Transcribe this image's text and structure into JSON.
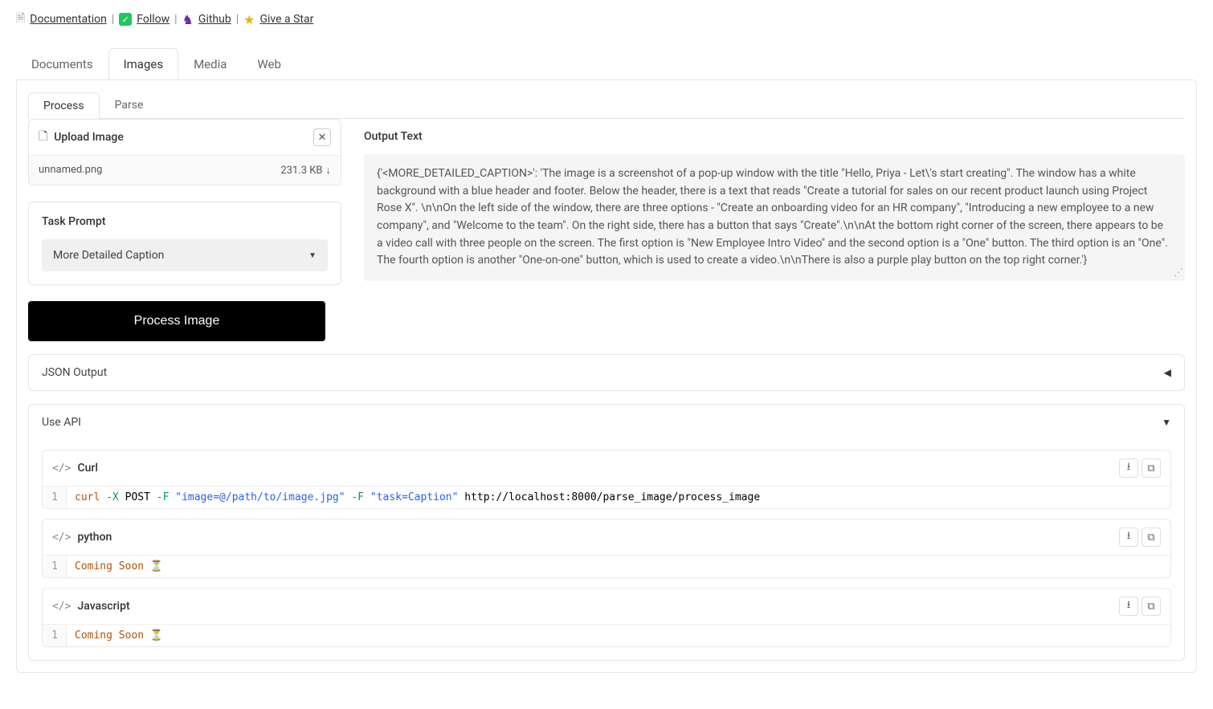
{
  "top_links": {
    "documentation": "Documentation",
    "follow": "Follow",
    "github": "Github",
    "star": "Give a Star"
  },
  "main_tabs": [
    "Documents",
    "Images",
    "Media",
    "Web"
  ],
  "sub_tabs": [
    "Process",
    "Parse"
  ],
  "upload": {
    "title": "Upload Image",
    "filename": "unnamed.png",
    "filesize": "231.3 KB"
  },
  "task_prompt": {
    "label": "Task Prompt",
    "selected": "More Detailed Caption"
  },
  "process_button": "Process Image",
  "output": {
    "label": "Output Text",
    "text": "{'<MORE_DETAILED_CAPTION>': 'The image is a screenshot of a pop-up window with the title \"Hello, Priya - Let\\'s start creating\". The window has a white background with a blue header and footer. Below the header, there is a text that reads \"Create a tutorial for sales on our recent product launch using Project Rose X\". \\n\\nOn the left side of the window, there are three options - \"Create an onboarding video for an HR company\", \"Introducing a new employee to a new company\", and \"Welcome to the team\". On the right side, there has a button that says \"Create\".\\n\\nAt the bottom right corner of the screen, there appears to be a video call with three people on the screen. The first option is \"New Employee Intro Video\" and the second option is a \"One\" button. The third option is an \"One\". The fourth option is another \"One-on-one\" button, which is used to create a video.\\n\\nThere is also a purple play button on the top right corner.'}"
  },
  "json_output": {
    "title": "JSON Output"
  },
  "api": {
    "title": "Use API",
    "blocks": [
      {
        "lang": "Curl",
        "line_no": "1",
        "code_raw": "curl -X POST -F \"image=@/path/to/image.jpg\" -F \"task=Caption\" http://localhost:8000/parse_image/process_image",
        "tokens": {
          "cmd": "curl",
          "flag1": "-X",
          "method": "POST",
          "flag2": "-F",
          "str1": "\"image=@/path/to/image.jpg\"",
          "flag3": "-F",
          "str2": "\"task=Caption\"",
          "url": "http://localhost:8000/parse_image/process_image"
        }
      },
      {
        "lang": "python",
        "line_no": "1",
        "soon": "Coming Soon"
      },
      {
        "lang": "Javascript",
        "line_no": "1",
        "soon": "Coming Soon"
      }
    ]
  }
}
